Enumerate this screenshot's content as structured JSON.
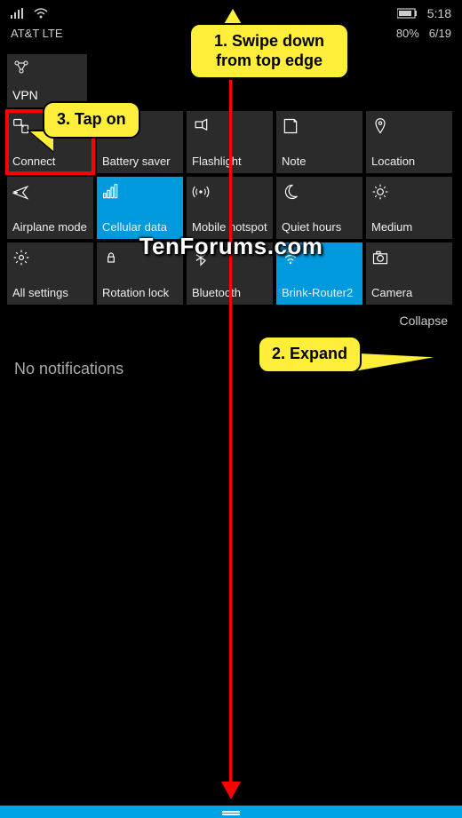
{
  "statusbar": {
    "time": "5:18",
    "battery_pct": "80%",
    "date": "6/19",
    "carrier": "AT&T LTE"
  },
  "vpn": {
    "label": "VPN"
  },
  "tiles": [
    {
      "label": "Connect",
      "icon": "connect-icon",
      "active": false,
      "highlighted": true
    },
    {
      "label": "Battery saver",
      "icon": "battery-saver-icon",
      "active": false
    },
    {
      "label": "Flashlight",
      "icon": "flashlight-icon",
      "active": false
    },
    {
      "label": "Note",
      "icon": "note-icon",
      "active": false
    },
    {
      "label": "Location",
      "icon": "location-icon",
      "active": false
    },
    {
      "label": "Airplane mode",
      "icon": "airplane-icon",
      "active": false
    },
    {
      "label": "Cellular data",
      "icon": "cellular-icon",
      "active": true
    },
    {
      "label": "Mobile hotspot",
      "icon": "hotspot-icon",
      "active": false
    },
    {
      "label": "Quiet hours",
      "icon": "quiet-hours-icon",
      "active": false
    },
    {
      "label": "Medium",
      "icon": "brightness-icon",
      "active": false
    },
    {
      "label": "All settings",
      "icon": "settings-icon",
      "active": false
    },
    {
      "label": "Rotation lock",
      "icon": "rotation-lock-icon",
      "active": false
    },
    {
      "label": "Bluetooth",
      "icon": "bluetooth-icon",
      "active": false
    },
    {
      "label": "Brink-Router2",
      "icon": "wifi-icon",
      "active": true
    },
    {
      "label": "Camera",
      "icon": "camera-icon",
      "active": false
    }
  ],
  "collapse_label": "Collapse",
  "no_notifications": "No notifications",
  "annotations": {
    "step1": "1. Swipe down from top edge",
    "step2": "2. Expand",
    "step3": "3. Tap on"
  },
  "watermark": "TenForums.com"
}
